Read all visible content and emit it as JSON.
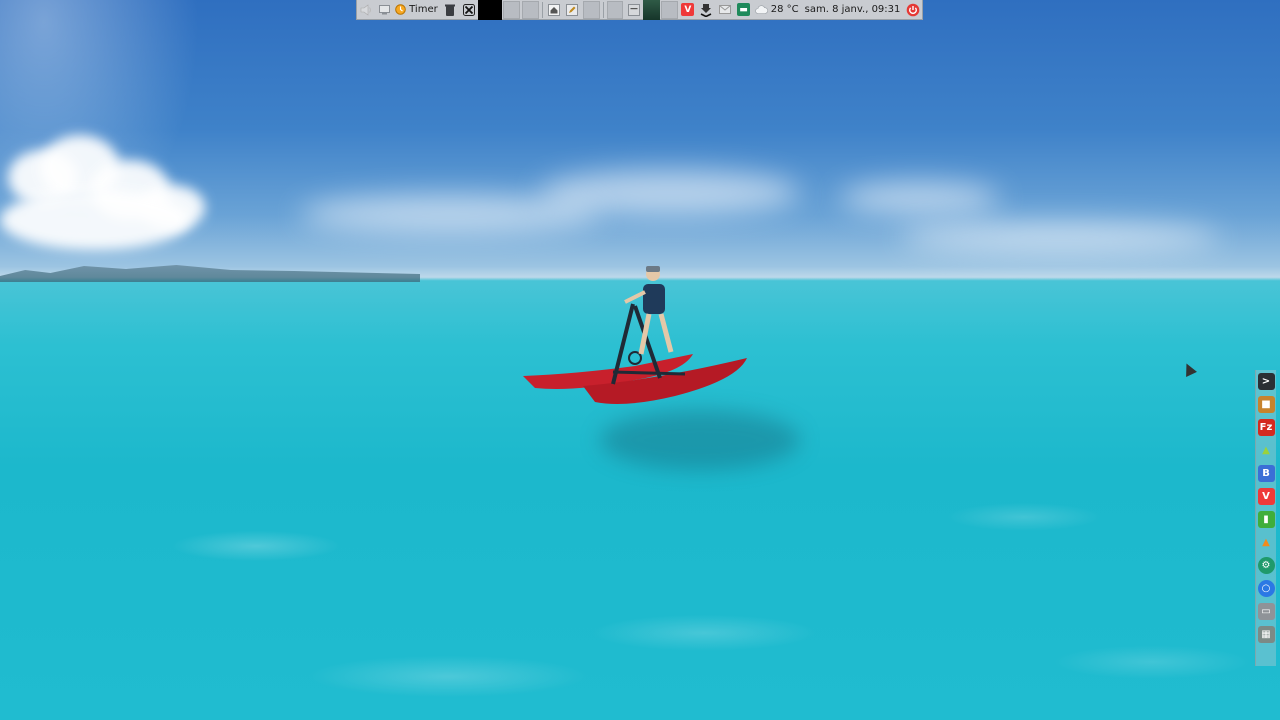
{
  "panel": {
    "timer_label": "Timer",
    "weather": "28 °C",
    "datetime": "sam.  8 janv., 09:31"
  },
  "icons": {
    "volume": "volume-icon",
    "timer": "clock-icon",
    "close": "close-icon",
    "home": "home-folder-icon",
    "vivaldi": "vivaldi-icon",
    "download": "download-arrow-icon",
    "files": "file-manager-icon",
    "weather": "cloud-icon",
    "power": "power-icon"
  },
  "colors": {
    "panel_bg": "#c9ccd1",
    "vivaldi_red": "#ef3939",
    "power_red": "#e53935",
    "filezilla_red": "#d42a20"
  }
}
